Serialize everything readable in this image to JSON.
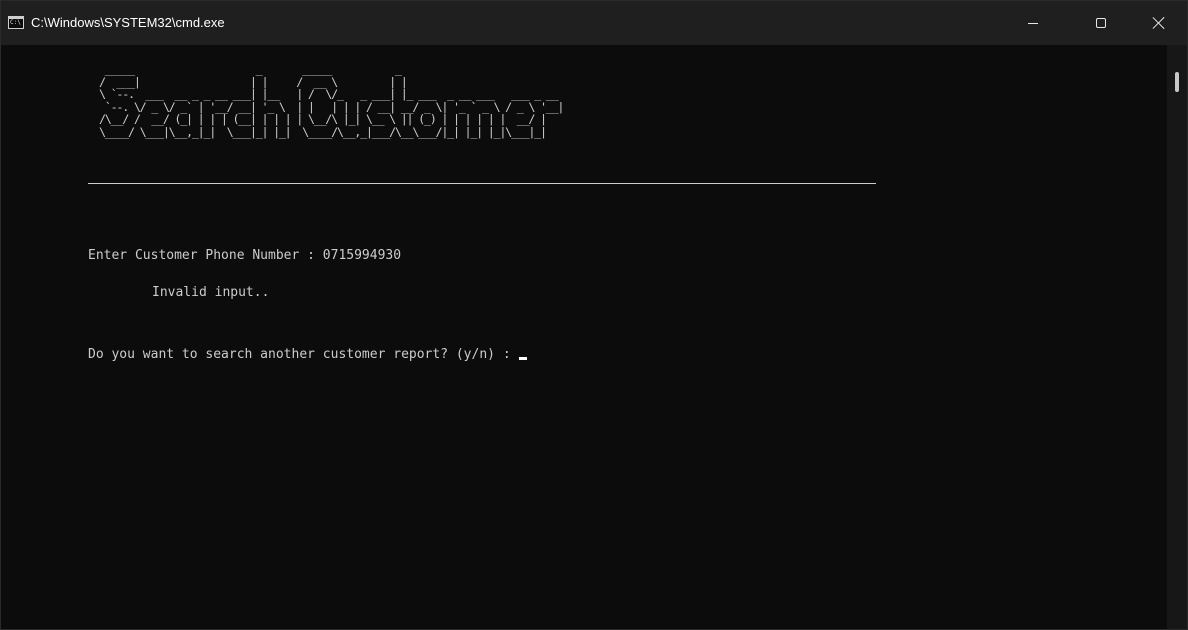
{
  "window": {
    "title": "C:\\Windows\\SYSTEM32\\cmd.exe",
    "icon": "cmd-icon",
    "icon_text": "C:\\",
    "controls": {
      "minimize": "minimize-icon",
      "maximize": "maximize-icon",
      "close": "close-icon"
    }
  },
  "console": {
    "banner": " _____                     _       _____           _                            \n/  ___|                   | |     /  __ \\         | |                           \n\\ `--.  ___  __ _ _ __ ___| |__   | /  \\/_   _ ___| |_ ___  _ __ ___   ___ _ __ \n `--. \\/ _ \\/ _` | '__/ __| '_ \\  | |   | | | / __| __/ _ \\| '_ ` _ \\ / _ \\ '__|\n/\\__/ /  __/ (_| | | | (__| | | | | \\__/\\ |_| \\__ \\ || (_) | | | | | |  __/ |   \n\\____/ \\___|\\__,_|_|  \\___|_| |_|  \\____/\\__,_|___/\\__\\___/|_| |_| |_|\\___|_|   ",
    "banner_label": "Search Customer",
    "phone_prompt": "Enter Customer Phone Number : 0715994930",
    "invalid_message": "Invalid input..",
    "again_prompt": "Do you want to search another customer report? (y/n) :"
  },
  "colors": {
    "background": "#0c0c0c",
    "titlebar": "#1f1f1f",
    "text": "#cccccc",
    "cursor": "#ffffff"
  }
}
